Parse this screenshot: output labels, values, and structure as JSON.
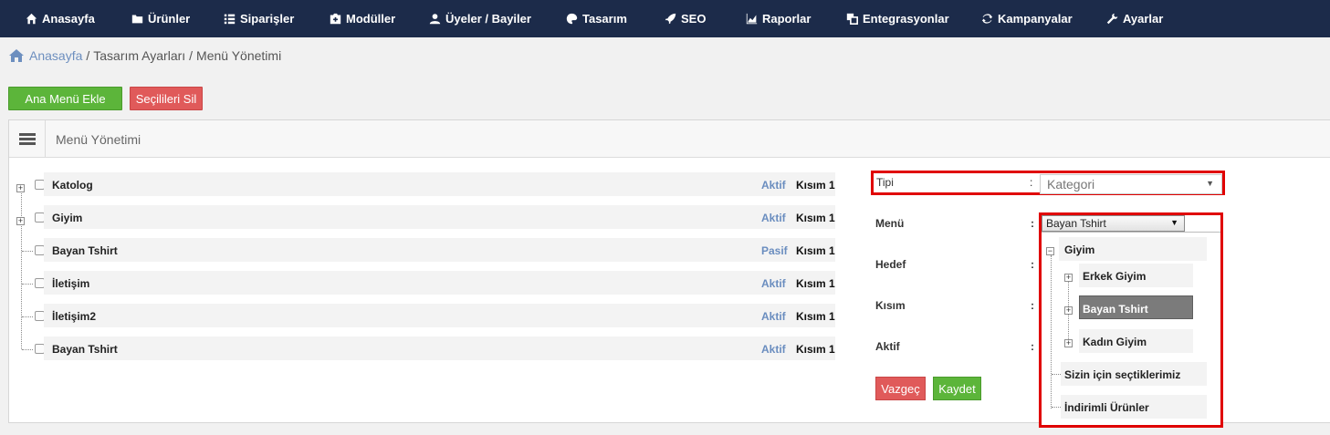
{
  "nav": {
    "items": [
      {
        "label": "Anasayfa",
        "icon": "home-icon"
      },
      {
        "label": "Ürünler",
        "icon": "folder-icon"
      },
      {
        "label": "Siparişler",
        "icon": "list-icon"
      },
      {
        "label": "Modüller",
        "icon": "plus-box-icon"
      },
      {
        "label": "Üyeler / Bayiler",
        "icon": "user-icon"
      },
      {
        "label": "Tasarım",
        "icon": "palette-icon"
      },
      {
        "label": "SEO",
        "icon": "rocket-icon"
      },
      {
        "label": "Raporlar",
        "icon": "chart-icon"
      },
      {
        "label": "Entegrasyonlar",
        "icon": "windows-icon"
      },
      {
        "label": "Kampanyalar",
        "icon": "refresh-icon"
      },
      {
        "label": "Ayarlar",
        "icon": "wrench-icon"
      }
    ]
  },
  "breadcrumb": {
    "home": "Anasayfa",
    "separator": "/",
    "items": [
      "Tasarım Ayarları",
      "Menü Yönetimi"
    ]
  },
  "actions": {
    "add_main_menu": "Ana Menü Ekle",
    "delete_selected": "Seçilileri Sil"
  },
  "panel": {
    "title": "Menü Yönetimi"
  },
  "menu_rows": [
    {
      "name": "Katolog",
      "status": "Aktif",
      "section": "Kısım 1"
    },
    {
      "name": "Giyim",
      "status": "Aktif",
      "section": "Kısım 1"
    },
    {
      "name": "Bayan Tshirt",
      "status": "Pasif",
      "section": "Kısım 1"
    },
    {
      "name": "İletişim",
      "status": "Aktif",
      "section": "Kısım 1"
    },
    {
      "name": "İletişim2",
      "status": "Aktif",
      "section": "Kısım 1"
    },
    {
      "name": "Bayan Tshirt",
      "status": "Aktif",
      "section": "Kısım 1"
    }
  ],
  "form": {
    "colon": ":",
    "labels": {
      "tipi": "Tipi",
      "menu": "Menü",
      "hedef": "Hedef",
      "kisim": "Kısım",
      "aktif": "Aktif"
    },
    "tipi_value": "Kategori",
    "menu_value": "Bayan Tshirt",
    "cancel": "Vazgeç",
    "save": "Kaydet"
  },
  "dropdown_tree": [
    {
      "label": "Giyim"
    },
    {
      "label": "Erkek Giyim"
    },
    {
      "label": "Bayan Tshirt"
    },
    {
      "label": "Kadın Giyim"
    },
    {
      "label": "Sizin için seçtiklerimiz"
    },
    {
      "label": "İndirimli Ürünler"
    }
  ],
  "colors": {
    "nav_bg": "#1c2b4a",
    "green": "#5cb53a",
    "red": "#e05a5a",
    "status_blue": "#6a8dbf",
    "highlight_red": "#e00000"
  }
}
